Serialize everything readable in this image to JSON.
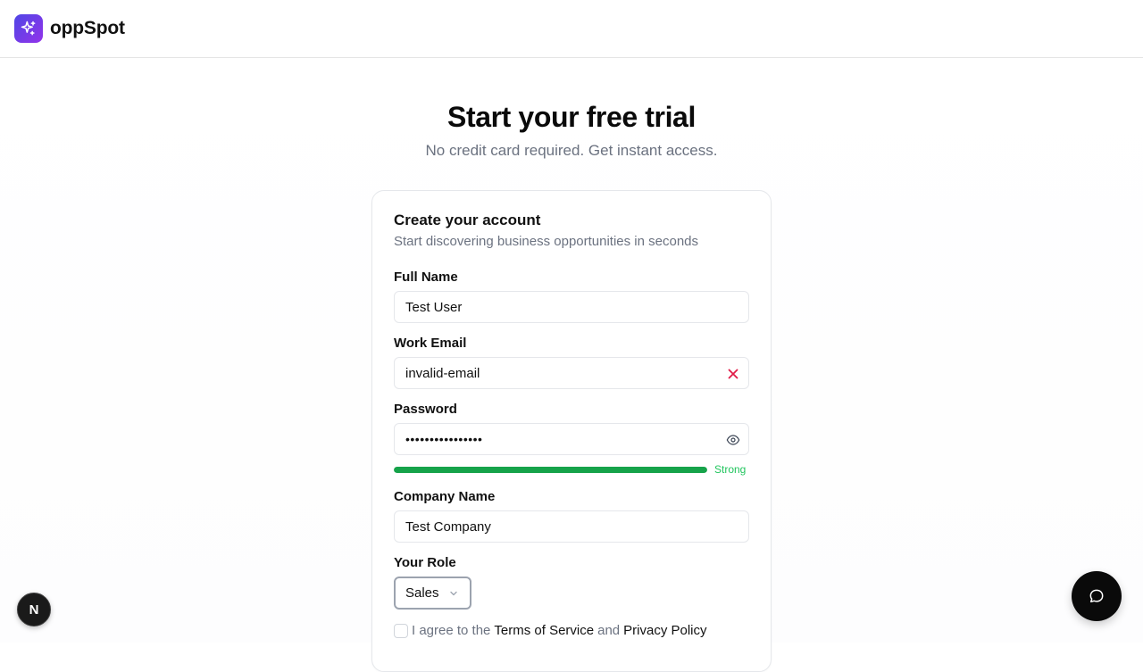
{
  "app": {
    "name": "oppSpot",
    "logo_icon": "sparkles-icon",
    "accent": "#7c3aed"
  },
  "hero": {
    "title": "Start your free trial",
    "subtitle": "No credit card required. Get instant access."
  },
  "form": {
    "title": "Create your account",
    "subtitle": "Start discovering business opportunities in seconds",
    "full_name": {
      "label": "Full Name",
      "value": "Test User"
    },
    "email": {
      "label": "Work Email",
      "value": "invalid-email",
      "status_icon": "x-icon",
      "status_color": "#e11d48"
    },
    "password": {
      "label": "Password",
      "value": "••••••••••••••••",
      "toggle_icon": "eye-icon"
    },
    "strength": {
      "label": "Strong",
      "level": 1.0,
      "color": "#16a34a"
    },
    "company": {
      "label": "Company Name",
      "value": "Test Company"
    },
    "role": {
      "label": "Your Role",
      "value": "Sales",
      "icon": "chevron-down-icon"
    },
    "agree": {
      "prefix": "I agree to the",
      "terms": "Terms of Service",
      "and": "and",
      "privacy": "Privacy Policy"
    }
  },
  "floating": {
    "dev_badge": "N",
    "chat_icon": "chat-bubble-icon"
  }
}
